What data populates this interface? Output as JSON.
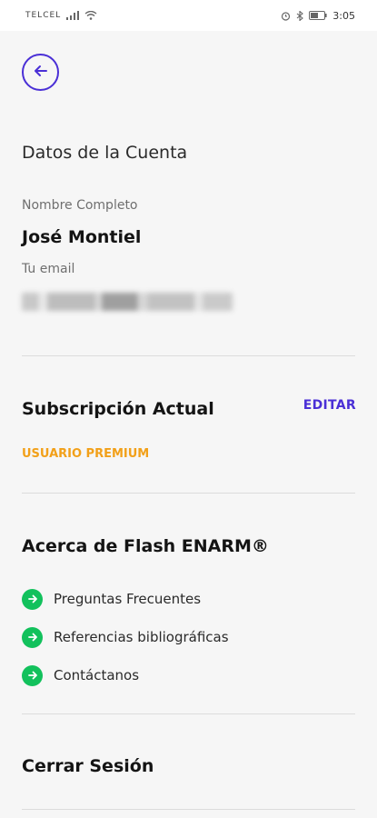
{
  "status_bar": {
    "carrier": "TELCEL",
    "time": "3:05",
    "icons": [
      "signal-icon",
      "wifi-icon",
      "alarm-icon",
      "bluetooth-icon",
      "battery-icon"
    ]
  },
  "back_icon": "arrow-left-icon",
  "account": {
    "title": "Datos de la Cuenta",
    "name_label": "Nombre Completo",
    "name_value": "José Montiel",
    "email_label": "Tu email"
  },
  "subscription": {
    "title": "Subscripción Actual",
    "edit_label": "EDITAR",
    "plan": "USUARIO PREMIUM"
  },
  "about": {
    "title": "Acerca de Flash ENARM®",
    "links": [
      {
        "label": "Preguntas Frecuentes"
      },
      {
        "label": "Referencias bibliográficas"
      },
      {
        "label": "Contáctanos"
      }
    ]
  },
  "logout_label": "Cerrar Sesión",
  "colors": {
    "accent": "#4a2fd6",
    "premium": "#f2a019",
    "link_icon": "#12c15c",
    "background": "#f6f6f6"
  }
}
